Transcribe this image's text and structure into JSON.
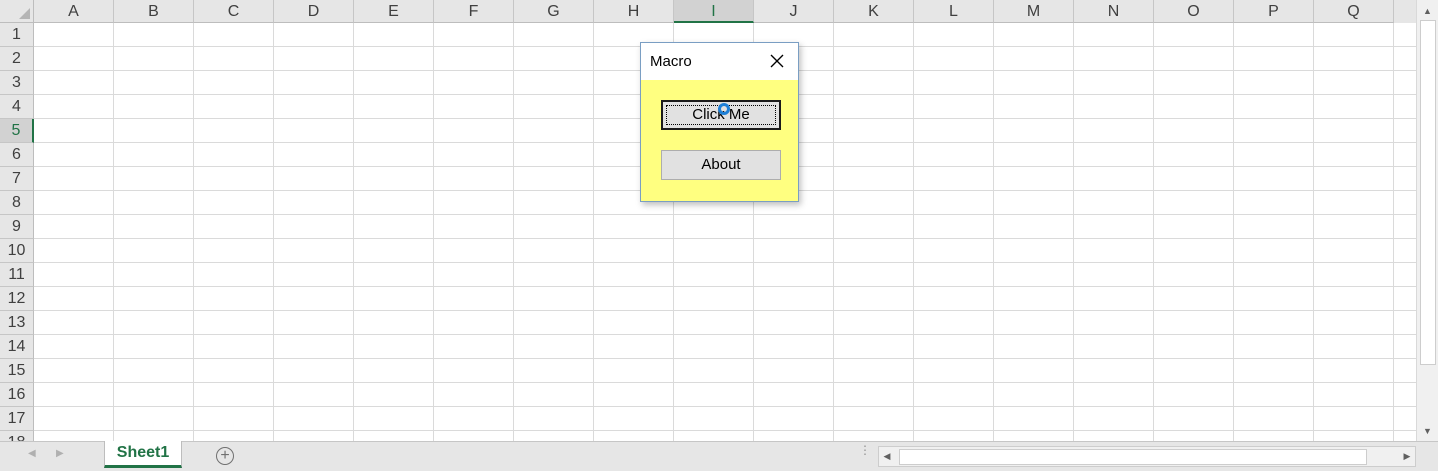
{
  "spreadsheet": {
    "columns": [
      "A",
      "B",
      "C",
      "D",
      "E",
      "F",
      "G",
      "H",
      "I",
      "J",
      "K",
      "L",
      "M",
      "N",
      "O",
      "P",
      "Q"
    ],
    "rows": [
      "1",
      "2",
      "3",
      "4",
      "5",
      "6",
      "7",
      "8",
      "9",
      "10",
      "11",
      "12",
      "13",
      "14",
      "15",
      "16",
      "17",
      "18"
    ],
    "selected_column": "I",
    "selected_row": "5"
  },
  "tabs": {
    "sheets": [
      "Sheet1"
    ],
    "active_sheet": "Sheet1"
  },
  "dialog": {
    "title": "Macro",
    "background_color": "#ffff80",
    "buttons": {
      "click_me": "Click Me",
      "about": "About"
    }
  },
  "colors": {
    "accent": "#217346",
    "cursor": "#1e7fd6"
  },
  "icons": {
    "close": "close-icon",
    "add_sheet": "add-sheet-icon",
    "scroll_up": "arrow-up-icon",
    "scroll_down": "arrow-down-icon",
    "scroll_left": "arrow-left-icon",
    "scroll_right": "arrow-right-icon"
  }
}
